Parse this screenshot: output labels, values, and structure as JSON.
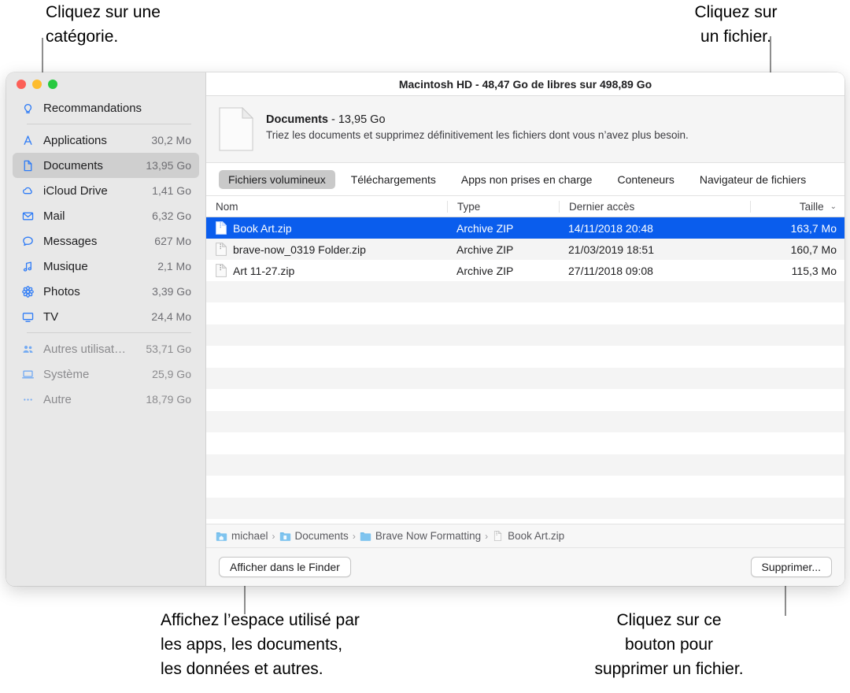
{
  "callouts": {
    "category": "Cliquez sur une\ncatégorie.",
    "file": "Cliquez sur\nun fichier.",
    "space": "Affichez l’espace utilisé par\nles apps, les documents,\nles données et autres.",
    "delete": "Cliquez sur ce\nbouton pour\nsupprimer un fichier."
  },
  "window": {
    "title": "Macintosh HD - 48,47 Go de libres sur 498,89 Go"
  },
  "sidebar": {
    "groups": [
      {
        "items": [
          {
            "icon": "lightbulb-icon",
            "label": "Recommandations",
            "size": "",
            "selected": false,
            "dim": false
          }
        ]
      },
      {
        "items": [
          {
            "icon": "appstore-icon",
            "label": "Applications",
            "size": "30,2 Mo",
            "selected": false,
            "dim": false
          },
          {
            "icon": "document-icon",
            "label": "Documents",
            "size": "13,95 Go",
            "selected": true,
            "dim": false
          },
          {
            "icon": "cloud-icon",
            "label": "iCloud Drive",
            "size": "1,41 Go",
            "selected": false,
            "dim": false
          },
          {
            "icon": "envelope-icon",
            "label": "Mail",
            "size": "6,32 Go",
            "selected": false,
            "dim": false
          },
          {
            "icon": "chat-bubble-icon",
            "label": "Messages",
            "size": "627 Mo",
            "selected": false,
            "dim": false
          },
          {
            "icon": "music-note-icon",
            "label": "Musique",
            "size": "2,1 Mo",
            "selected": false,
            "dim": false
          },
          {
            "icon": "photos-icon",
            "label": "Photos",
            "size": "3,39 Go",
            "selected": false,
            "dim": false
          },
          {
            "icon": "tv-icon",
            "label": "TV",
            "size": "24,4 Mo",
            "selected": false,
            "dim": false
          }
        ]
      },
      {
        "items": [
          {
            "icon": "users-icon",
            "label": "Autres utilisat…",
            "size": "53,71 Go",
            "selected": false,
            "dim": true
          },
          {
            "icon": "laptop-icon",
            "label": "Système",
            "size": "25,9 Go",
            "selected": false,
            "dim": true
          },
          {
            "icon": "ellipsis-icon",
            "label": "Autre",
            "size": "18,79 Go",
            "selected": false,
            "dim": true
          }
        ]
      }
    ]
  },
  "summary": {
    "title_name": "Documents",
    "title_rest": " - 13,95 Go",
    "subtitle": "Triez les documents et supprimez définitivement les fichiers dont vous n’avez plus besoin."
  },
  "tabs": [
    {
      "label": "Fichiers volumineux",
      "active": true
    },
    {
      "label": "Téléchargements",
      "active": false
    },
    {
      "label": "Apps non prises en charge",
      "active": false
    },
    {
      "label": "Conteneurs",
      "active": false
    },
    {
      "label": "Navigateur de fichiers",
      "active": false
    }
  ],
  "table": {
    "columns": {
      "name": "Nom",
      "type": "Type",
      "date": "Dernier accès",
      "size": "Taille"
    },
    "sort_caret": "⌄",
    "rows": [
      {
        "icon": "zip-file-icon",
        "name": "Book Art.zip",
        "type": "Archive ZIP",
        "date": "14/11/2018 20:48",
        "size": "163,7 Mo",
        "selected": true
      },
      {
        "icon": "zip-file-icon",
        "name": "brave-now_0319 Folder.zip",
        "type": "Archive ZIP",
        "date": "21/03/2019 18:51",
        "size": "160,7 Mo",
        "selected": false
      },
      {
        "icon": "zip-file-icon",
        "name": "Art 11-27.zip",
        "type": "Archive ZIP",
        "date": "27/11/2018 09:08",
        "size": "115,3 Mo",
        "selected": false
      }
    ],
    "empty_row_count": 6
  },
  "breadcrumb": [
    {
      "icon": "home-folder-icon",
      "label": "michael"
    },
    {
      "icon": "documents-folder-icon",
      "label": "Documents"
    },
    {
      "icon": "folder-icon",
      "label": "Brave Now Formatting"
    },
    {
      "icon": "zip-file-icon",
      "label": "Book Art.zip"
    }
  ],
  "breadcrumb_separator": "›",
  "footer": {
    "reveal_label": "Afficher dans le Finder",
    "delete_label": "Supprimer..."
  },
  "colors": {
    "accent_blue": "#0a5ded",
    "icon_blue": "#2f7cf6",
    "sidebar_bg": "#e8e8e8",
    "selected_sidebar": "#cfcfcf",
    "stripe": "#f4f4f4"
  }
}
